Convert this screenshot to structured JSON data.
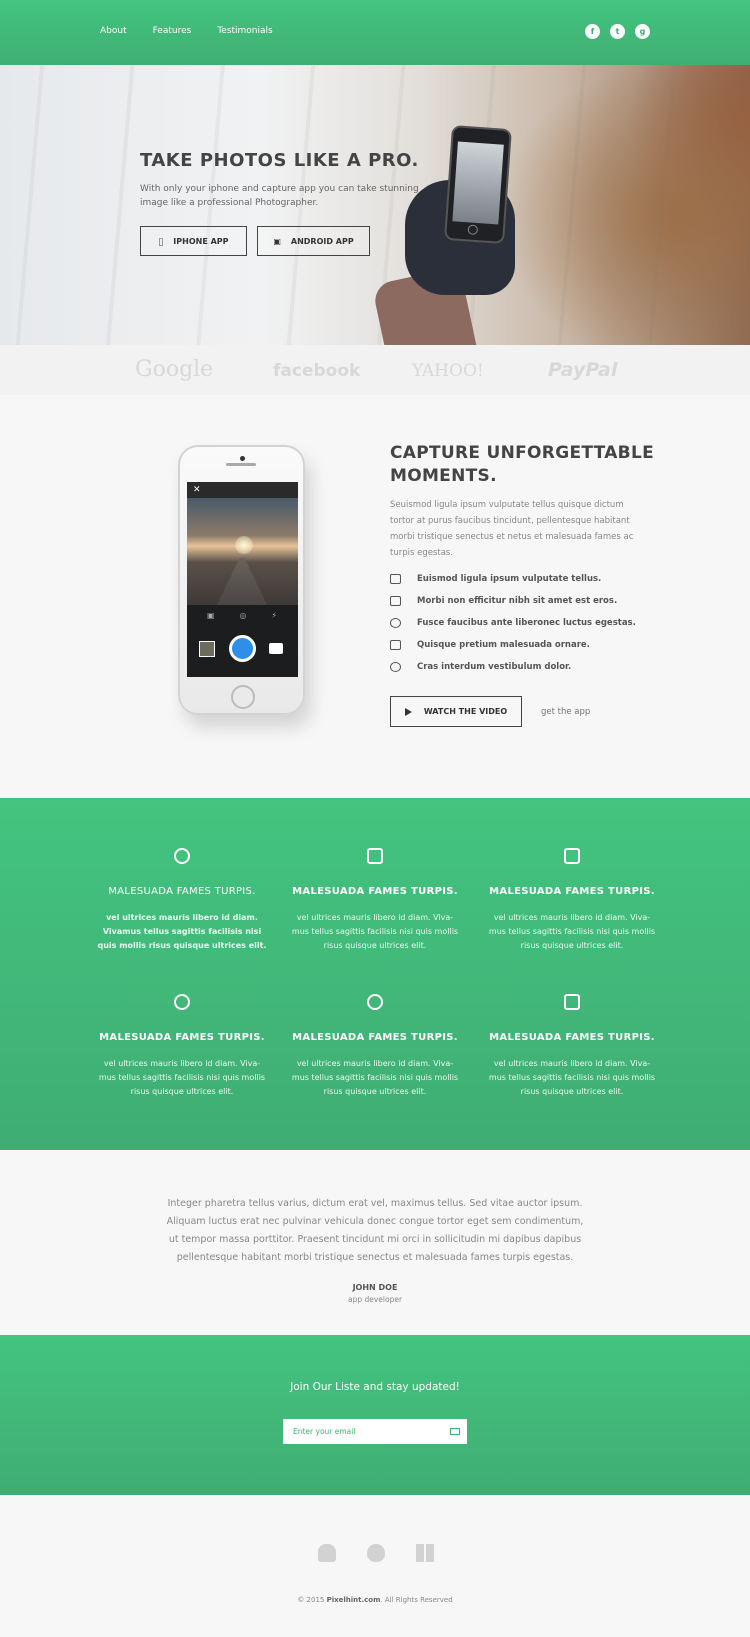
{
  "nav": {
    "items": [
      "About",
      "Features",
      "Testimonials"
    ]
  },
  "social": [
    "f",
    "t",
    "g"
  ],
  "hero": {
    "title": "TAKE PHOTOS LIKE A PRO.",
    "text": "With only your iphone and capture app you can take stunning image like a professional Photographer.",
    "iphone_button": "IPHONE APP",
    "android_button": "ANDROID APP"
  },
  "logos": [
    "Google",
    "facebook",
    "YAHOO!",
    "PayPal"
  ],
  "capture": {
    "title": "CAPTURE UNFORGETTABLE MOMENTS.",
    "text": "Seuismod ligula ipsum vulputate tellus quisque dictum tortor at purus faucibus tincidunt, pellentesque habitant morbi tristique senectus et netus et malesuada fames ac turpis egestas.",
    "features": [
      "Euismod ligula ipsum vulputate tellus.",
      "Morbi non efficitur nibh sit amet est eros.",
      "Fusce faucibus ante liberonec luctus egestas.",
      "Quisque pretium malesuada ornare.",
      "Cras interdum vestibulum dolor."
    ],
    "watch_button": "WATCH THE VIDEO",
    "get_app": "get the app"
  },
  "features": [
    {
      "title": "MALESUADA FAMES TURPIS.",
      "text": "vel ultrices mauris libero id diam. Vivamus tellus sagittis facilisis nisi quis mollis risus quisque ultrices elit."
    },
    {
      "title": "MALESUADA FAMES TURPIS.",
      "text": "vel ultrices mauris libero id diam. Viva-mus tellus sagittis facilisis nisi quis mollis risus quisque ultrices elit."
    },
    {
      "title": "MALESUADA FAMES TURPIS.",
      "text": "vel ultrices mauris libero id diam. Viva-mus tellus sagittis facilisis nisi quis mollis risus quisque ultrices elit."
    },
    {
      "title": "MALESUADA FAMES TURPIS.",
      "text": "vel ultrices mauris libero id diam. Viva-mus tellus sagittis facilisis nisi quis mollis risus quisque ultrices elit."
    },
    {
      "title": "MALESUADA FAMES TURPIS.",
      "text": "vel ultrices mauris libero id diam. Viva-mus tellus sagittis facilisis nisi quis mollis risus quisque ultrices elit."
    },
    {
      "title": "MALESUADA FAMES TURPIS.",
      "text": "vel ultrices mauris libero id diam. Viva-mus tellus sagittis facilisis nisi quis mollis risus quisque ultrices elit."
    }
  ],
  "testimonial": {
    "quote": "Integer pharetra tellus varius, dictum erat vel, maximus tellus. Sed vitae auctor ipsum. Aliquam luctus erat nec pulvinar vehicula donec congue tortor eget sem condimentum, ut tempor massa porttitor. Praesent tincidunt mi orci  in sollicitudin mi dapibus dapibus pellentesque habitant morbi tristique senectus et malesuada fames turpis egestas.",
    "author": "JOHN DOE",
    "role": "app developer"
  },
  "newsletter": {
    "title": "Join Our Liste and stay updated!",
    "placeholder": "Enter your email"
  },
  "footer": {
    "copyright_prefix": "© 2015 ",
    "copyright_brand": "Pixelhint.com",
    "copyright_suffix": ". All Rights Reserved"
  },
  "colors": {
    "accent": "#43c47f",
    "accent_dark": "#3faf72",
    "text_dark": "#444444"
  }
}
